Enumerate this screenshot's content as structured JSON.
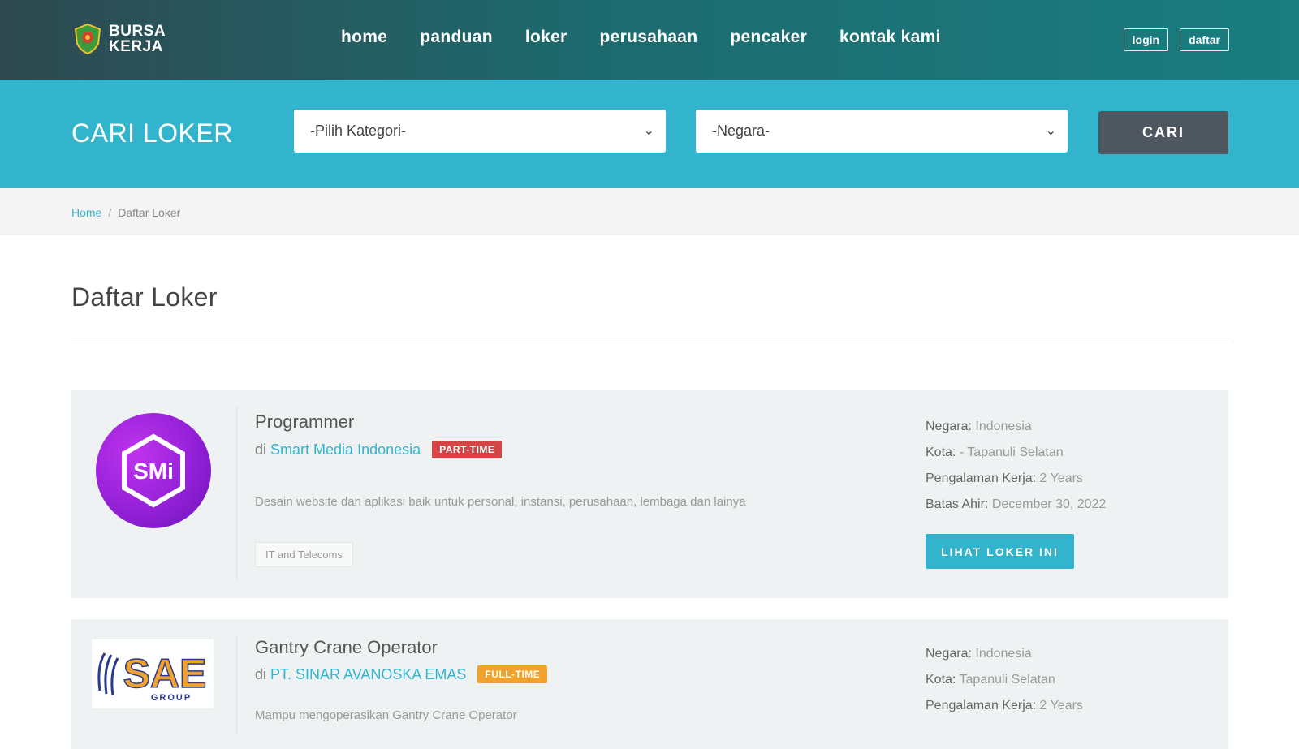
{
  "header": {
    "logo_line1": "BURSA",
    "logo_line2": "KERJA",
    "nav": [
      "home",
      "panduan",
      "loker",
      "perusahaan",
      "pencaker",
      "kontak kami"
    ],
    "login_label": "login",
    "register_label": "daftar"
  },
  "search": {
    "title": "CARI LOKER",
    "category_value": "-Pilih Kategori-",
    "country_value": "-Negara-",
    "button_label": "CARI"
  },
  "breadcrumb": {
    "home": "Home",
    "separator": "/",
    "current": "Daftar Loker"
  },
  "page_title": "Daftar Loker",
  "jobs": [
    {
      "logo_text": "SMi",
      "title": "Programmer",
      "company_prefix": "di",
      "company": "Smart Media Indonesia",
      "type": "PART-TIME",
      "description": "Desain website dan aplikasi baik untuk personal, instansi, perusahaan, lembaga dan lainya",
      "category_tag": "IT and Telecoms",
      "negara_label": "Negara:",
      "negara": "Indonesia",
      "kota_label": "Kota:",
      "kota": "- Tapanuli Selatan",
      "pengalaman_label": "Pengalaman Kerja:",
      "pengalaman": "2 Years",
      "batas_label": "Batas Ahir:",
      "batas": "December 30, 2022",
      "button_label": "LIHAT LOKER INI"
    },
    {
      "logo_text": "SAE",
      "logo_subtext": "GROUP",
      "title": "Gantry Crane Operator",
      "company_prefix": "di",
      "company": "PT. SINAR AVANOSKA EMAS",
      "type": "FULL-TIME",
      "description": "Mampu mengoperasikan Gantry Crane Operator",
      "negara_label": "Negara:",
      "negara": "Indonesia",
      "kota_label": "Kota:",
      "kota": "Tapanuli Selatan",
      "pengalaman_label": "Pengalaman Kerja:",
      "pengalaman": "2 Years"
    }
  ],
  "colors": {
    "header_dark": "#2e4950",
    "accent_teal": "#32b5cc",
    "search_button": "#4e5760",
    "badge_part_time": "#d64545",
    "badge_full_time": "#f0a22e"
  }
}
